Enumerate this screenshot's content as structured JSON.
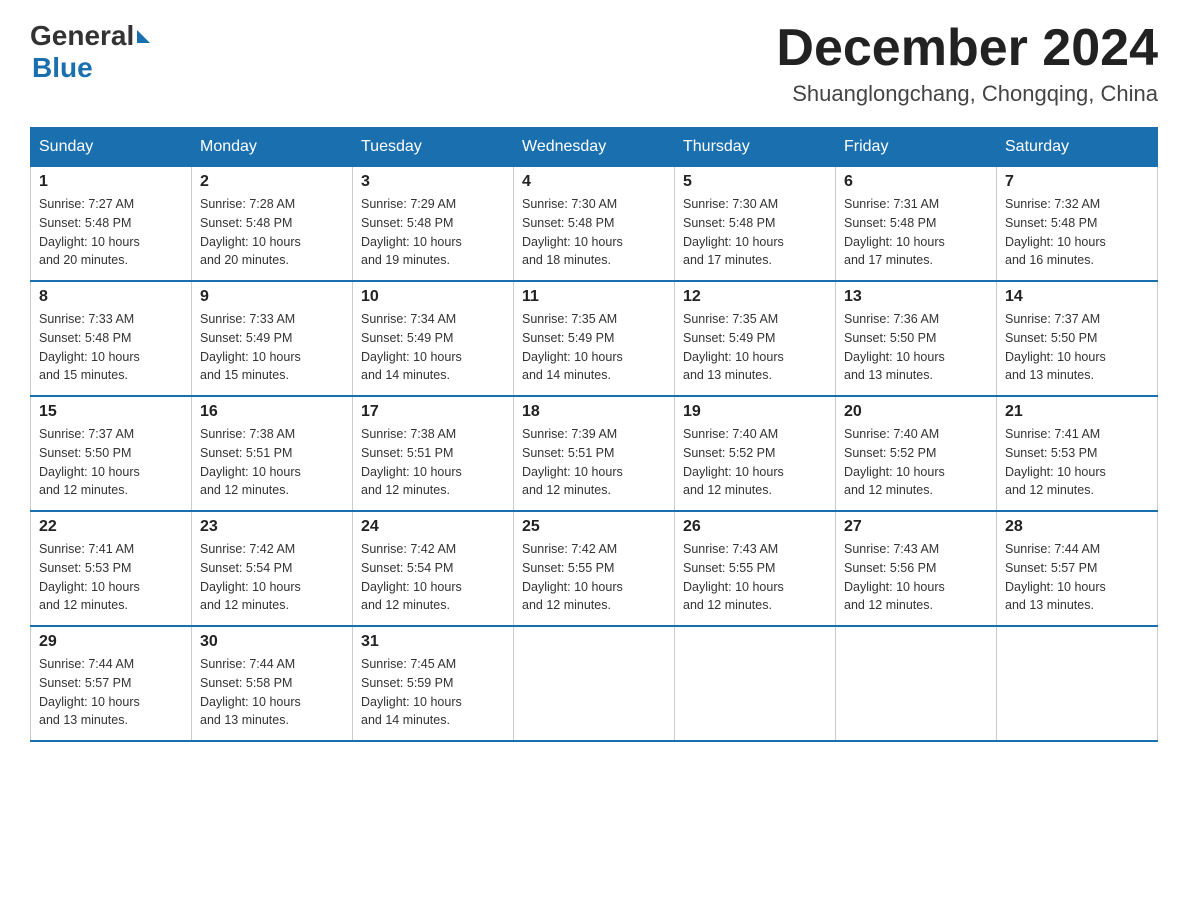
{
  "header": {
    "logo_general": "General",
    "logo_blue": "Blue",
    "month_title": "December 2024",
    "location": "Shuanglongchang, Chongqing, China"
  },
  "days_of_week": [
    "Sunday",
    "Monday",
    "Tuesday",
    "Wednesday",
    "Thursday",
    "Friday",
    "Saturday"
  ],
  "weeks": [
    [
      {
        "day": "1",
        "sunrise": "7:27 AM",
        "sunset": "5:48 PM",
        "daylight": "10 hours and 20 minutes."
      },
      {
        "day": "2",
        "sunrise": "7:28 AM",
        "sunset": "5:48 PM",
        "daylight": "10 hours and 20 minutes."
      },
      {
        "day": "3",
        "sunrise": "7:29 AM",
        "sunset": "5:48 PM",
        "daylight": "10 hours and 19 minutes."
      },
      {
        "day": "4",
        "sunrise": "7:30 AM",
        "sunset": "5:48 PM",
        "daylight": "10 hours and 18 minutes."
      },
      {
        "day": "5",
        "sunrise": "7:30 AM",
        "sunset": "5:48 PM",
        "daylight": "10 hours and 17 minutes."
      },
      {
        "day": "6",
        "sunrise": "7:31 AM",
        "sunset": "5:48 PM",
        "daylight": "10 hours and 17 minutes."
      },
      {
        "day": "7",
        "sunrise": "7:32 AM",
        "sunset": "5:48 PM",
        "daylight": "10 hours and 16 minutes."
      }
    ],
    [
      {
        "day": "8",
        "sunrise": "7:33 AM",
        "sunset": "5:48 PM",
        "daylight": "10 hours and 15 minutes."
      },
      {
        "day": "9",
        "sunrise": "7:33 AM",
        "sunset": "5:49 PM",
        "daylight": "10 hours and 15 minutes."
      },
      {
        "day": "10",
        "sunrise": "7:34 AM",
        "sunset": "5:49 PM",
        "daylight": "10 hours and 14 minutes."
      },
      {
        "day": "11",
        "sunrise": "7:35 AM",
        "sunset": "5:49 PM",
        "daylight": "10 hours and 14 minutes."
      },
      {
        "day": "12",
        "sunrise": "7:35 AM",
        "sunset": "5:49 PM",
        "daylight": "10 hours and 13 minutes."
      },
      {
        "day": "13",
        "sunrise": "7:36 AM",
        "sunset": "5:50 PM",
        "daylight": "10 hours and 13 minutes."
      },
      {
        "day": "14",
        "sunrise": "7:37 AM",
        "sunset": "5:50 PM",
        "daylight": "10 hours and 13 minutes."
      }
    ],
    [
      {
        "day": "15",
        "sunrise": "7:37 AM",
        "sunset": "5:50 PM",
        "daylight": "10 hours and 12 minutes."
      },
      {
        "day": "16",
        "sunrise": "7:38 AM",
        "sunset": "5:51 PM",
        "daylight": "10 hours and 12 minutes."
      },
      {
        "day": "17",
        "sunrise": "7:38 AM",
        "sunset": "5:51 PM",
        "daylight": "10 hours and 12 minutes."
      },
      {
        "day": "18",
        "sunrise": "7:39 AM",
        "sunset": "5:51 PM",
        "daylight": "10 hours and 12 minutes."
      },
      {
        "day": "19",
        "sunrise": "7:40 AM",
        "sunset": "5:52 PM",
        "daylight": "10 hours and 12 minutes."
      },
      {
        "day": "20",
        "sunrise": "7:40 AM",
        "sunset": "5:52 PM",
        "daylight": "10 hours and 12 minutes."
      },
      {
        "day": "21",
        "sunrise": "7:41 AM",
        "sunset": "5:53 PM",
        "daylight": "10 hours and 12 minutes."
      }
    ],
    [
      {
        "day": "22",
        "sunrise": "7:41 AM",
        "sunset": "5:53 PM",
        "daylight": "10 hours and 12 minutes."
      },
      {
        "day": "23",
        "sunrise": "7:42 AM",
        "sunset": "5:54 PM",
        "daylight": "10 hours and 12 minutes."
      },
      {
        "day": "24",
        "sunrise": "7:42 AM",
        "sunset": "5:54 PM",
        "daylight": "10 hours and 12 minutes."
      },
      {
        "day": "25",
        "sunrise": "7:42 AM",
        "sunset": "5:55 PM",
        "daylight": "10 hours and 12 minutes."
      },
      {
        "day": "26",
        "sunrise": "7:43 AM",
        "sunset": "5:55 PM",
        "daylight": "10 hours and 12 minutes."
      },
      {
        "day": "27",
        "sunrise": "7:43 AM",
        "sunset": "5:56 PM",
        "daylight": "10 hours and 12 minutes."
      },
      {
        "day": "28",
        "sunrise": "7:44 AM",
        "sunset": "5:57 PM",
        "daylight": "10 hours and 13 minutes."
      }
    ],
    [
      {
        "day": "29",
        "sunrise": "7:44 AM",
        "sunset": "5:57 PM",
        "daylight": "10 hours and 13 minutes."
      },
      {
        "day": "30",
        "sunrise": "7:44 AM",
        "sunset": "5:58 PM",
        "daylight": "10 hours and 13 minutes."
      },
      {
        "day": "31",
        "sunrise": "7:45 AM",
        "sunset": "5:59 PM",
        "daylight": "10 hours and 14 minutes."
      },
      null,
      null,
      null,
      null
    ]
  ],
  "labels": {
    "sunrise": "Sunrise:",
    "sunset": "Sunset:",
    "daylight": "Daylight:"
  }
}
